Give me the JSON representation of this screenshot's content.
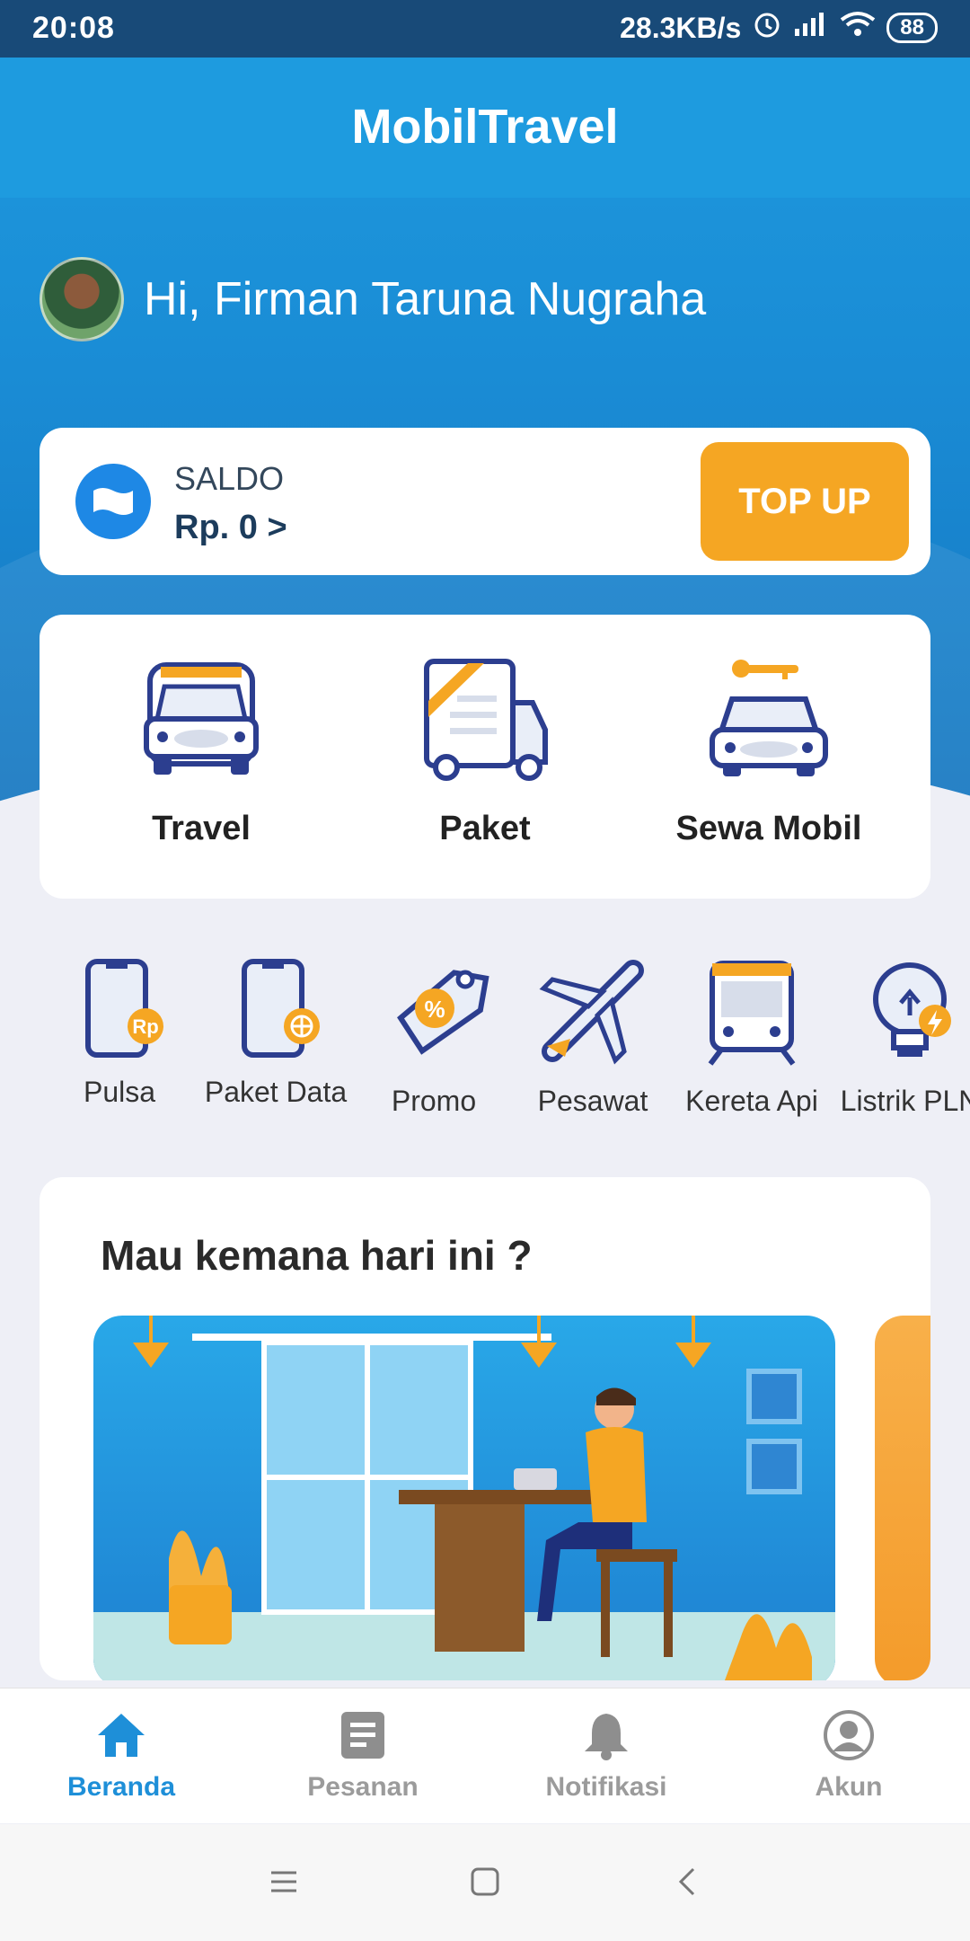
{
  "status": {
    "time": "20:08",
    "speed": "28.3KB/s",
    "battery": "88"
  },
  "app": {
    "title": "MobilTravel"
  },
  "greeting": "Hi, Firman Taruna Nugraha",
  "balance": {
    "label": "SALDO",
    "value": "Rp. 0 >",
    "topup_label": "TOP UP"
  },
  "services": [
    {
      "label": "Travel",
      "icon": "van-icon"
    },
    {
      "label": "Paket",
      "icon": "truck-icon"
    },
    {
      "label": "Sewa Mobil",
      "icon": "car-key-icon"
    }
  ],
  "quick_menu": [
    {
      "label": "Pulsa",
      "icon": "phone-credit-icon"
    },
    {
      "label": "Paket Data",
      "icon": "phone-data-icon"
    },
    {
      "label": "Promo",
      "icon": "promo-tag-icon"
    },
    {
      "label": "Pesawat",
      "icon": "airplane-icon"
    },
    {
      "label": "Kereta Api",
      "icon": "train-icon"
    },
    {
      "label": "Listrik PLN",
      "icon": "bulb-icon"
    }
  ],
  "destination": {
    "title": "Mau kemana hari ini ?"
  },
  "bottom_nav": [
    {
      "label": "Beranda",
      "icon": "home-icon",
      "active": true
    },
    {
      "label": "Pesanan",
      "icon": "orders-icon",
      "active": false
    },
    {
      "label": "Notifikasi",
      "icon": "bell-icon",
      "active": false
    },
    {
      "label": "Akun",
      "icon": "account-icon",
      "active": false
    }
  ],
  "colors": {
    "primary": "#1E9BDF",
    "accent": "#F5A623",
    "navy": "#2C3E8F"
  }
}
